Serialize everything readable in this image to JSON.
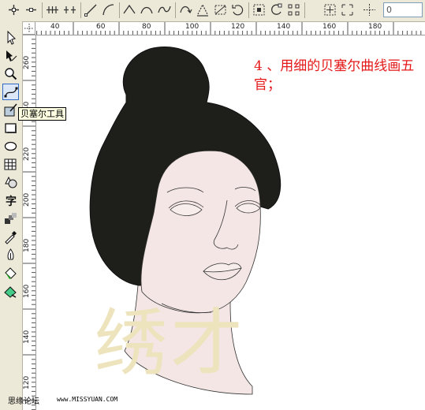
{
  "toolbar": {
    "zoom_value": "0",
    "buttons": [
      "add-node-icon",
      "delete-node-icon",
      "join-nodes-icon",
      "break-curve-icon",
      "line-to-curve-icon",
      "curve-to-line-icon",
      "cusp-node-icon",
      "smooth-node-icon",
      "symmetric-node-icon",
      "reverse-curve-icon",
      "extend-curve-icon",
      "stretch-nodes-icon",
      "rotate-nodes-icon",
      "align-nodes-icon",
      "select-all-nodes-icon",
      "elastic-mode-icon"
    ]
  },
  "toolbox": {
    "tools": [
      "pick-tool-icon",
      "shape-tool-icon",
      "zoom-tool-icon",
      "bezier-tool-icon",
      "smart-fill-tool-icon",
      "rectangle-tool-icon",
      "ellipse-tool-icon",
      "graph-paper-tool-icon",
      "basic-shapes-tool-icon",
      "text-tool-icon",
      "interactive-blend-tool-icon",
      "eyedropper-tool-icon",
      "outline-tool-icon",
      "fill-tool-icon",
      "interactive-fill-tool-icon"
    ],
    "active_tool": "bezier-tool-icon",
    "tooltip": "贝塞尔工具"
  },
  "rulers": {
    "h_labels": [
      "40",
      "60",
      "80",
      "100",
      "120",
      "140",
      "160",
      "180"
    ],
    "v_labels": [
      "260",
      "240",
      "220",
      "200",
      "180",
      "160",
      "140",
      "120"
    ]
  },
  "canvas": {
    "note": "4 、用细的贝塞尔曲线画五官；",
    "watermark": "绣才"
  },
  "footer": {
    "left": "思缘论坛",
    "right": "www.MISSYUAN.COM"
  },
  "colors": {
    "hair": "#1e1e1a",
    "skin": "#f3e6e4",
    "note_text": "#e51818",
    "watermark": "#ede3bd",
    "toolbar_bg": "#ece9d8"
  }
}
